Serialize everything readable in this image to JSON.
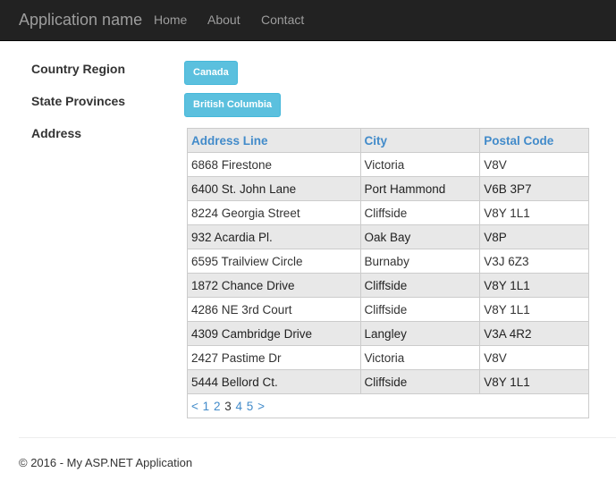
{
  "navbar": {
    "brand": "Application name",
    "links": [
      "Home",
      "About",
      "Contact"
    ]
  },
  "filters": {
    "country_label": "Country Region",
    "country_value": "Canada",
    "state_label": "State Provinces",
    "state_value": "British Columbia",
    "address_label": "Address"
  },
  "table": {
    "headers": [
      "Address Line",
      "City",
      "Postal Code"
    ],
    "rows": [
      [
        "6868 Firestone",
        "Victoria",
        "V8V"
      ],
      [
        "6400 St. John Lane",
        "Port Hammond",
        "V6B 3P7"
      ],
      [
        "8224 Georgia Street",
        "Cliffside",
        "V8Y 1L1"
      ],
      [
        "932 Acardia Pl.",
        "Oak Bay",
        "V8P"
      ],
      [
        "6595 Trailview Circle",
        "Burnaby",
        "V3J 6Z3"
      ],
      [
        "1872 Chance Drive",
        "Cliffside",
        "V8Y 1L1"
      ],
      [
        "4286 NE 3rd Court",
        "Cliffside",
        "V8Y 1L1"
      ],
      [
        "4309 Cambridge Drive",
        "Langley",
        "V3A 4R2"
      ],
      [
        "2427 Pastime Dr",
        "Victoria",
        "V8V"
      ],
      [
        "5444 Bellord Ct.",
        "Cliffside",
        "V8Y 1L1"
      ]
    ],
    "pager": {
      "prev": "<",
      "pages": [
        "1",
        "2",
        "3",
        "4",
        "5"
      ],
      "current": "3",
      "next": ">"
    }
  },
  "footer": {
    "text": "© 2016 - My ASP.NET Application"
  }
}
